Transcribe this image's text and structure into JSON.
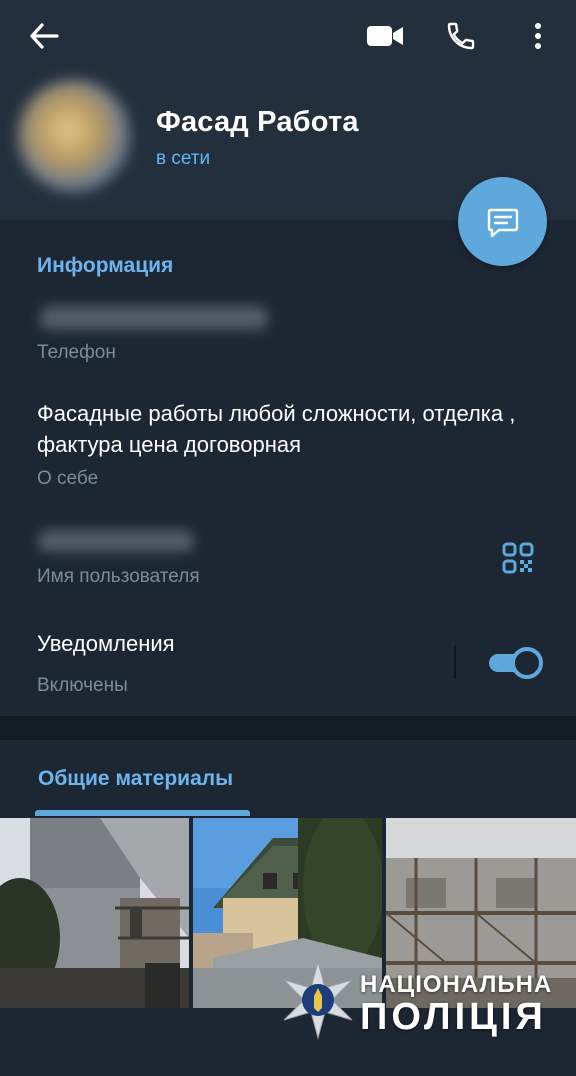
{
  "header": {
    "title": "Фасад Работа",
    "status": "в сети",
    "icons": [
      "back-arrow-icon",
      "video-camera-icon",
      "phone-icon",
      "more-vertical-icon"
    ]
  },
  "fab": {
    "icon": "message-icon"
  },
  "info": {
    "section_title": "Информация",
    "phone_label": "Телефон",
    "bio_text": "Фасадные работы любой сложности, отделка , фактура цена договорная",
    "bio_label": "О себе",
    "username_label": "Имя пользователя",
    "qr_icon": "qr-code-icon",
    "notifications_title": "Уведомления",
    "notifications_state": "Включены",
    "notifications_enabled": true
  },
  "media": {
    "tab_label": "Общие материалы",
    "thumbnails": [
      "house-photo-1",
      "house-photo-2",
      "house-photo-3"
    ]
  },
  "watermark": {
    "line1": "НАЦІОНАЛЬНА",
    "line2": "ПОЛІЦІЯ"
  },
  "colors": {
    "accent": "#5ea8dc",
    "link": "#6cb4ee",
    "header_bg": "#242f3d",
    "body_bg": "#1d2733"
  }
}
